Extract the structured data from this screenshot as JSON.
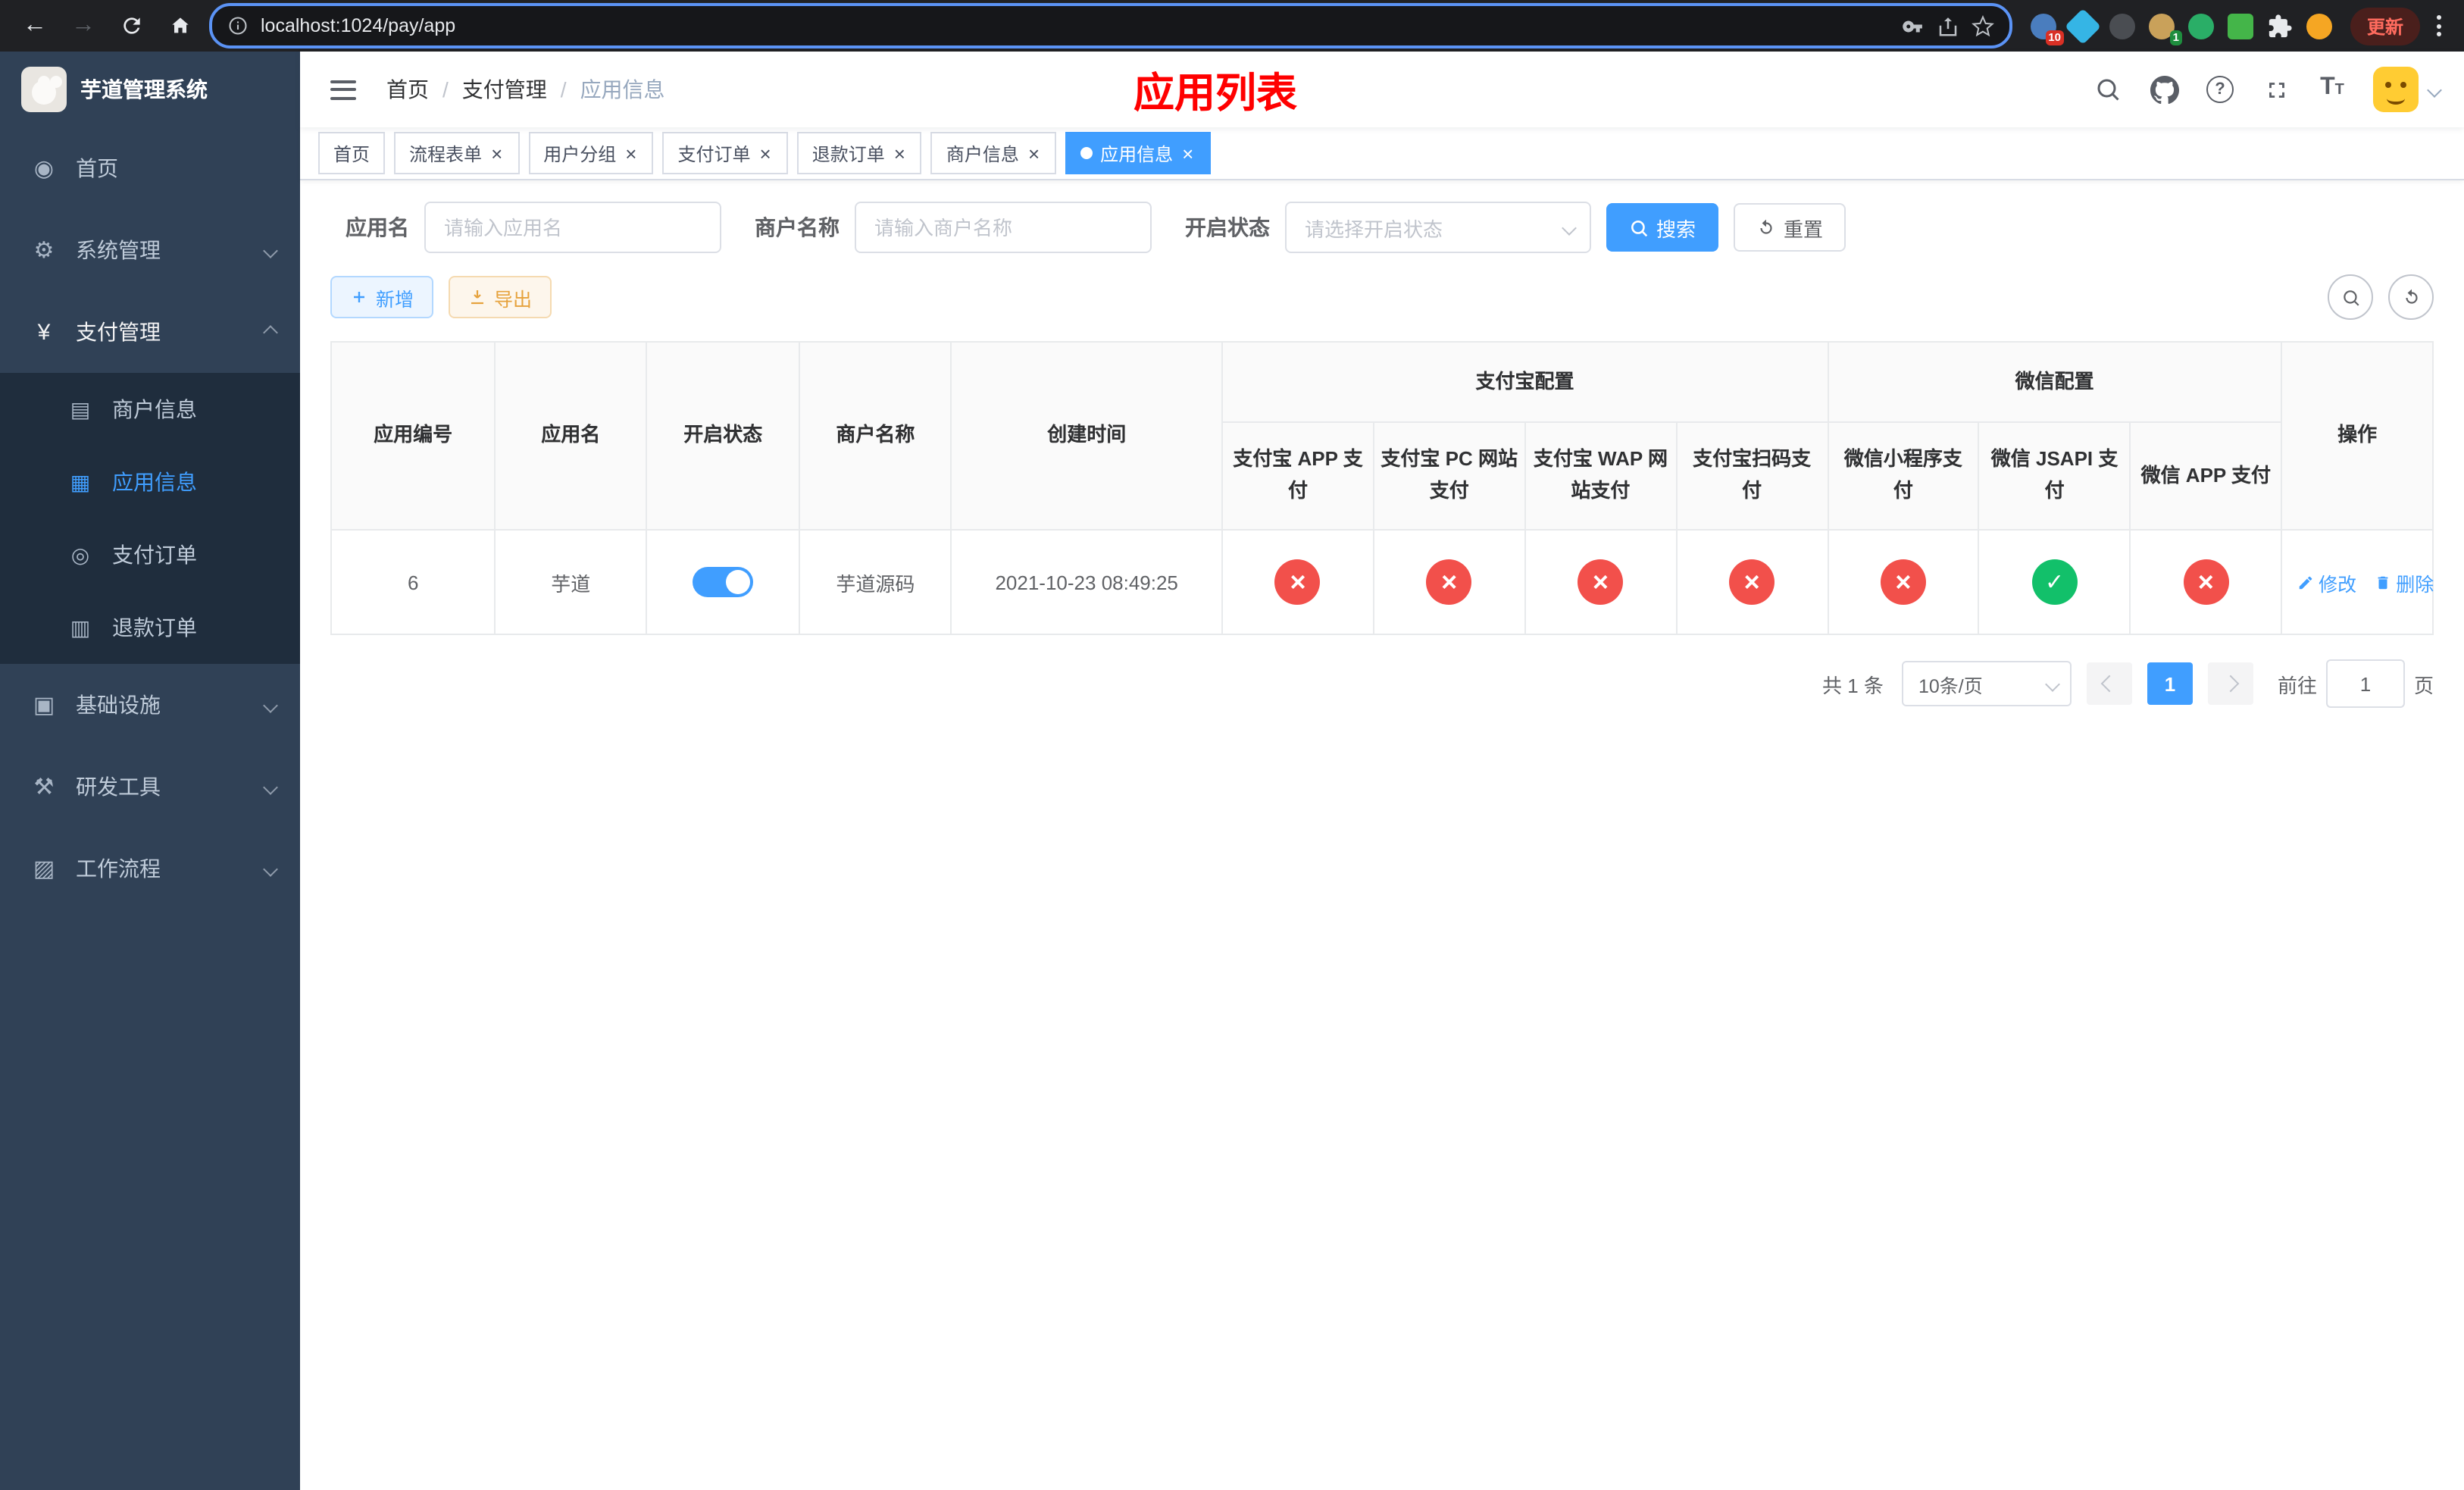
{
  "browser": {
    "url": "localhost:1024/pay/app",
    "update_label": "更新",
    "ext_badge_count": "10",
    "ext_badge_count2": "1"
  },
  "sidebar": {
    "title": "芋道管理系统",
    "menu": [
      {
        "label": "首页"
      },
      {
        "label": "系统管理"
      },
      {
        "label": "支付管理"
      },
      {
        "label": "基础设施"
      },
      {
        "label": "研发工具"
      },
      {
        "label": "工作流程"
      }
    ],
    "submenu": [
      {
        "label": "商户信息"
      },
      {
        "label": "应用信息"
      },
      {
        "label": "支付订单"
      },
      {
        "label": "退款订单"
      }
    ]
  },
  "navbar": {
    "breadcrumb": [
      "首页",
      "支付管理",
      "应用信息"
    ],
    "page_title": "应用列表"
  },
  "tabs": [
    {
      "label": "首页"
    },
    {
      "label": "流程表单"
    },
    {
      "label": "用户分组"
    },
    {
      "label": "支付订单"
    },
    {
      "label": "退款订单"
    },
    {
      "label": "商户信息"
    },
    {
      "label": "应用信息"
    }
  ],
  "filter": {
    "app_name_label": "应用名",
    "app_name_placeholder": "请输入应用名",
    "merchant_label": "商户名称",
    "merchant_placeholder": "请输入商户名称",
    "status_label": "开启状态",
    "status_placeholder": "请选择开启状态",
    "search_label": "搜索",
    "reset_label": "重置"
  },
  "toolbar": {
    "add_label": "新增",
    "export_label": "导出"
  },
  "table": {
    "headers": {
      "app_id": "应用编号",
      "app_name": "应用名",
      "status": "开启状态",
      "merchant": "商户名称",
      "create_time": "创建时间",
      "alipay_group": "支付宝配置",
      "wechat_group": "微信配置",
      "alipay_app": "支付宝 APP 支付",
      "alipay_pc": "支付宝 PC 网站支付",
      "alipay_wap": "支付宝 WAP 网站支付",
      "alipay_qr": "支付宝扫码支付",
      "wx_lite": "微信小程序支付",
      "wx_jsapi": "微信 JSAPI 支付",
      "wx_app": "微信 APP 支付",
      "actions": "操作"
    },
    "row": {
      "app_id": "6",
      "app_name": "芋道",
      "switch_state": "on",
      "merchant": "芋道源码",
      "create_time": "2021-10-23 08:49:25",
      "configs": {
        "alipay_app": "off",
        "alipay_pc": "off",
        "alipay_wap": "off",
        "alipay_qr": "off",
        "wx_lite": "off",
        "wx_jsapi": "on",
        "wx_app": "off"
      },
      "edit_label": "修改",
      "delete_label": "删除"
    }
  },
  "pagination": {
    "total": "共 1 条",
    "page_size": "10条/页",
    "current_page": "1",
    "goto_label": "前往",
    "goto_value": "1",
    "goto_suffix": "页"
  },
  "colors": {
    "primary": "#409eff",
    "danger": "#f2504b",
    "success": "#12c06a",
    "title_red": "#ff0000",
    "sidebar_bg": "#304156",
    "submenu_bg": "#1f2d3d"
  }
}
